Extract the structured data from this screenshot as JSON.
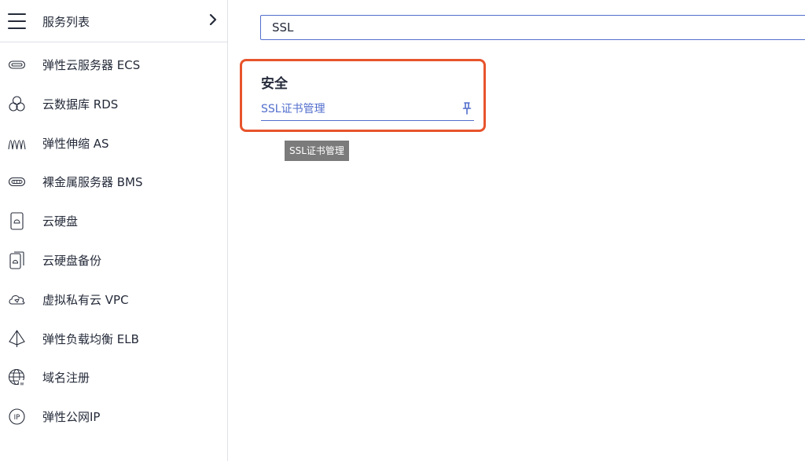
{
  "sidebar": {
    "title": "服务列表",
    "items": [
      {
        "label": "弹性云服务器 ECS",
        "icon": "cloud-server-icon"
      },
      {
        "label": "云数据库 RDS",
        "icon": "database-icon"
      },
      {
        "label": "弹性伸缩 AS",
        "icon": "auto-scaling-icon"
      },
      {
        "label": "裸金属服务器 BMS",
        "icon": "bare-metal-icon"
      },
      {
        "label": "云硬盘",
        "icon": "disk-icon"
      },
      {
        "label": "云硬盘备份",
        "icon": "disk-backup-icon"
      },
      {
        "label": "虚拟私有云 VPC",
        "icon": "vpc-icon"
      },
      {
        "label": "弹性负载均衡 ELB",
        "icon": "load-balancer-icon"
      },
      {
        "label": "域名注册",
        "icon": "domain-globe-icon"
      },
      {
        "label": "弹性公网IP",
        "icon": "eip-icon"
      }
    ]
  },
  "search": {
    "value": "SSL"
  },
  "results": {
    "category": "安全",
    "item_label": "SSL证书管理"
  },
  "tooltip": {
    "text": "SSL证书管理"
  },
  "colors": {
    "accent": "#526ecc",
    "highlight_border": "#e8542c",
    "text": "#252b3a",
    "tooltip_bg": "#7b7b7b"
  }
}
